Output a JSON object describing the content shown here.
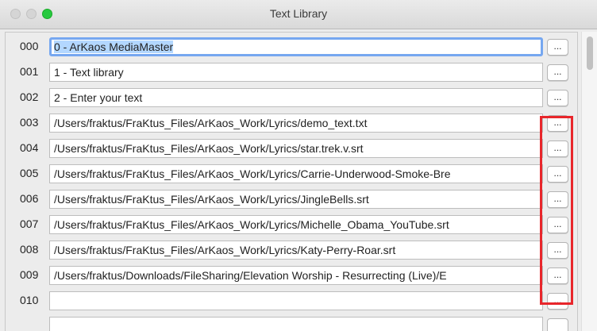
{
  "window": {
    "title": "Text Library"
  },
  "rows": [
    {
      "num": "000",
      "value": "0 - ArKaos MediaMaster",
      "button_label": "..."
    },
    {
      "num": "001",
      "value": "1 - Text library",
      "button_label": "..."
    },
    {
      "num": "002",
      "value": "2 - Enter your text",
      "button_label": "..."
    },
    {
      "num": "003",
      "value": "/Users/fraktus/FraKtus_Files/ArKaos_Work/Lyrics/demo_text.txt",
      "button_label": "..."
    },
    {
      "num": "004",
      "value": "/Users/fraktus/FraKtus_Files/ArKaos_Work/Lyrics/star.trek.v.srt",
      "button_label": "..."
    },
    {
      "num": "005",
      "value": "/Users/fraktus/FraKtus_Files/ArKaos_Work/Lyrics/Carrie-Underwood-Smoke-Bre",
      "button_label": "..."
    },
    {
      "num": "006",
      "value": "/Users/fraktus/FraKtus_Files/ArKaos_Work/Lyrics/JingleBells.srt",
      "button_label": "..."
    },
    {
      "num": "007",
      "value": "/Users/fraktus/FraKtus_Files/ArKaos_Work/Lyrics/Michelle_Obama_YouTube.srt",
      "button_label": "..."
    },
    {
      "num": "008",
      "value": "/Users/fraktus/FraKtus_Files/ArKaos_Work/Lyrics/Katy-Perry-Roar.srt",
      "button_label": "..."
    },
    {
      "num": "009",
      "value": "/Users/fraktus/Downloads/FileSharing/Elevation Worship - Resurrecting (Live)/E",
      "button_label": "..."
    },
    {
      "num": "010",
      "value": "",
      "button_label": "..."
    }
  ],
  "colors": {
    "focus": "#76a7f0",
    "highlight": "#e8262b",
    "selection": "#b3d7ff"
  }
}
